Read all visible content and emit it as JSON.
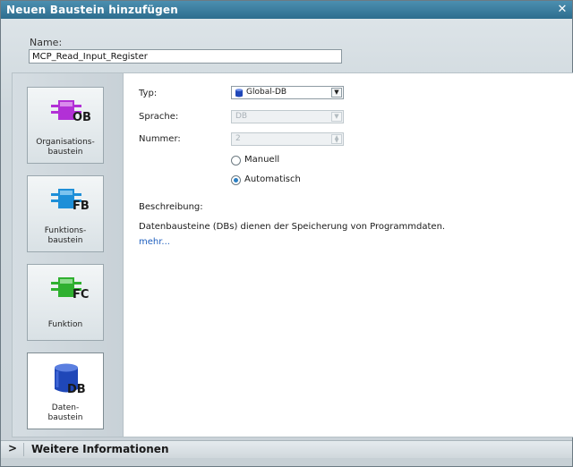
{
  "window": {
    "title": "Neuen Baustein hinzufügen",
    "close_glyph": "✕"
  },
  "name": {
    "label": "Name:",
    "value": "MCP_Read_Input_Register"
  },
  "blocks": [
    {
      "id": "ob",
      "code": "OB",
      "line1": "Organisations-",
      "line2": "baustein",
      "color": "#b230d6"
    },
    {
      "id": "fb",
      "code": "FB",
      "line1": "Funktions-",
      "line2": "baustein",
      "color": "#1e8fd8"
    },
    {
      "id": "fc",
      "code": "FC",
      "line1": "Funktion",
      "line2": "",
      "color": "#2fb030"
    },
    {
      "id": "db",
      "code": "DB",
      "line1": "Daten-",
      "line2": "baustein",
      "color": "#1f47b8"
    }
  ],
  "form": {
    "typ": {
      "label": "Typ:",
      "value": "Global-DB"
    },
    "sprache": {
      "label": "Sprache:",
      "value": "DB"
    },
    "nummer": {
      "label": "Nummer:",
      "value": "2"
    },
    "manuell": {
      "label": "Manuell"
    },
    "automatisch": {
      "label": "Automatisch"
    }
  },
  "description": {
    "label": "Beschreibung:",
    "text": "Datenbausteine (DBs) dienen der Speicherung von Programmdaten.",
    "more": "mehr..."
  },
  "footer": {
    "label": "Weitere Informationen",
    "chevron": ">"
  }
}
